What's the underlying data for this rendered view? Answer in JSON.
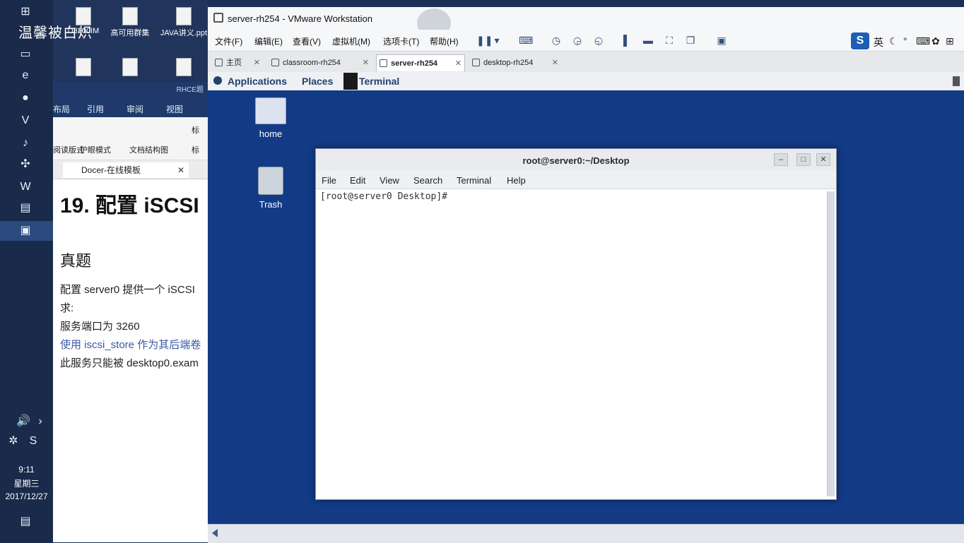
{
  "desktop": {
    "watermark": "温馨被白炽",
    "icons": [
      {
        "label": "D3200IM"
      },
      {
        "label": "高可用群集"
      },
      {
        "label": "JAVA讲义.ppt"
      }
    ]
  },
  "taskbar": {
    "time": "9:11",
    "weekday": "星期三",
    "date": "2017/12/27"
  },
  "word": {
    "title": "RHCE题",
    "menu": [
      "布局",
      "引用",
      "审阅",
      "视图"
    ],
    "ribbon": {
      "read_mode": "阅读版式",
      "protect_mode": "护眼模式",
      "doc_map": "文档结构图",
      "ruler1": "标",
      "ruler2": "标"
    },
    "tab_label": "Docer-在线模板",
    "heading": "19. 配置 iSCSI",
    "subheading": "真题",
    "lines": [
      "配置 server0 提供一个 iSCSI",
      "求:",
      "服务端口为 3260",
      "使用 iscsi_store 作为其后端卷",
      "此服务只能被 desktop0.exam"
    ]
  },
  "vmware": {
    "title": "server-rh254 - VMware Workstation",
    "menu": [
      "文件(F)",
      "编辑(E)",
      "查看(V)",
      "虚拟机(M)",
      "选项卡(T)",
      "帮助(H)"
    ],
    "ime_label": "英",
    "tabs": [
      {
        "label": "主页",
        "active": false
      },
      {
        "label": "classroom-rh254",
        "active": false
      },
      {
        "label": "server-rh254",
        "active": true
      },
      {
        "label": "desktop-rh254",
        "active": false
      }
    ]
  },
  "guest": {
    "top_bar": {
      "applications": "Applications",
      "places": "Places",
      "terminal": "Terminal"
    },
    "desktop_icons": [
      {
        "label": "home"
      },
      {
        "label": "Trash"
      }
    ],
    "terminal": {
      "title": "root@server0:~/Desktop",
      "menu": [
        "File",
        "Edit",
        "View",
        "Search",
        "Terminal",
        "Help"
      ],
      "prompt": "[root@server0 Desktop]#"
    }
  }
}
